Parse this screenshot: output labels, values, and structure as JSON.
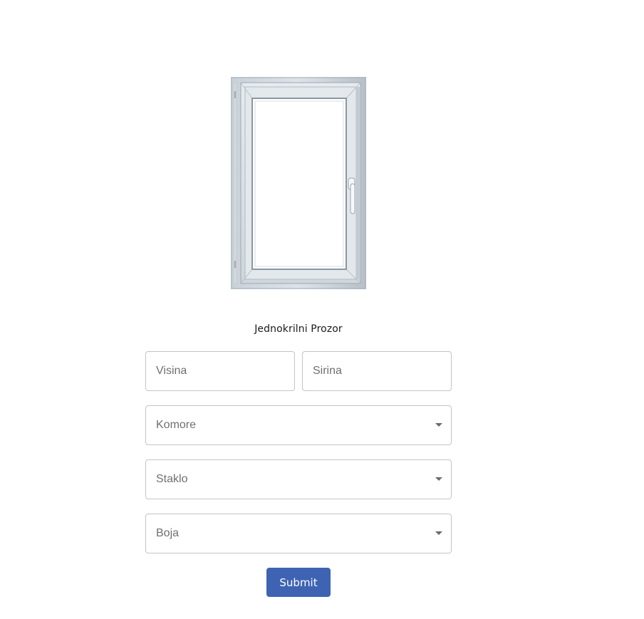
{
  "product": {
    "title": "Jednokrilni Prozor",
    "image_icon": "single-sash-window-image"
  },
  "form": {
    "visina": {
      "placeholder": "Visina",
      "value": ""
    },
    "sirina": {
      "placeholder": "Sirina",
      "value": ""
    },
    "komore": {
      "label": "Komore",
      "selected": ""
    },
    "staklo": {
      "label": "Staklo",
      "selected": ""
    },
    "boja": {
      "label": "Boja",
      "selected": ""
    },
    "submit_label": "Submit"
  },
  "colors": {
    "submit_button": "#3f63b3",
    "border": "#c4c4c4",
    "placeholder": "#6f6f6f"
  }
}
